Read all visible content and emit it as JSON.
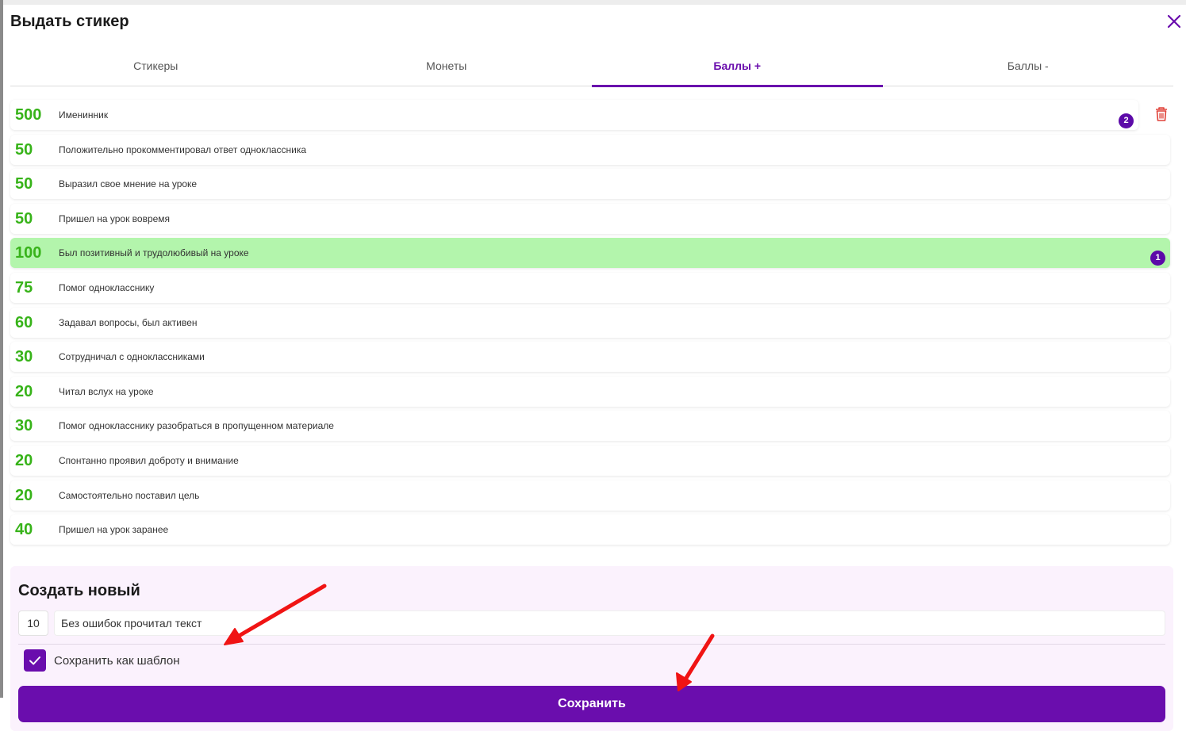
{
  "title": "Выдать стикер",
  "tabs": [
    {
      "label": "Стикеры"
    },
    {
      "label": "Монеты"
    },
    {
      "label": "Баллы +"
    },
    {
      "label": "Баллы -"
    }
  ],
  "active_tab": "Баллы +",
  "templates": [
    {
      "points": "500",
      "label": "Именинник",
      "badge": "2"
    },
    {
      "points": "50",
      "label": "Положительно прокомментировал ответ одноклассника"
    },
    {
      "points": "50",
      "label": "Выразил свое мнение на уроке"
    },
    {
      "points": "50",
      "label": "Пришел на урок вовремя"
    },
    {
      "points": "100",
      "label": "Был позитивный и трудолюбивый на уроке",
      "badge": "1",
      "selected": true
    },
    {
      "points": "75",
      "label": "Помог однокласснику"
    },
    {
      "points": "60",
      "label": "Задавал вопросы, был активен"
    },
    {
      "points": "30",
      "label": "Сотрудничал с одноклассниками"
    },
    {
      "points": "20",
      "label": "Читал вслух на уроке"
    },
    {
      "points": "30",
      "label": "Помог однокласснику разобраться в пропущенном материале"
    },
    {
      "points": "20",
      "label": "Спонтанно проявил доброту и внимание"
    },
    {
      "points": "20",
      "label": "Самостоятельно поставил цель"
    },
    {
      "points": "40",
      "label": "Пришел на урок заранее"
    }
  ],
  "create": {
    "title": "Создать новый",
    "points_value": "10",
    "text_value": "Без ошибок прочитал текст",
    "save_as_template_label": "Сохранить как шаблон",
    "save_as_template_checked": true,
    "save_button_label": "Сохранить"
  },
  "colors": {
    "accent": "#6a0dad",
    "points_green": "#37b319",
    "selected_row": "#b3f5ac",
    "delete_red": "#e0433a",
    "annotation_arrow": "#f01414"
  },
  "icons": {
    "close": "close-icon",
    "delete": "trash-icon",
    "check": "checkmark-icon"
  }
}
